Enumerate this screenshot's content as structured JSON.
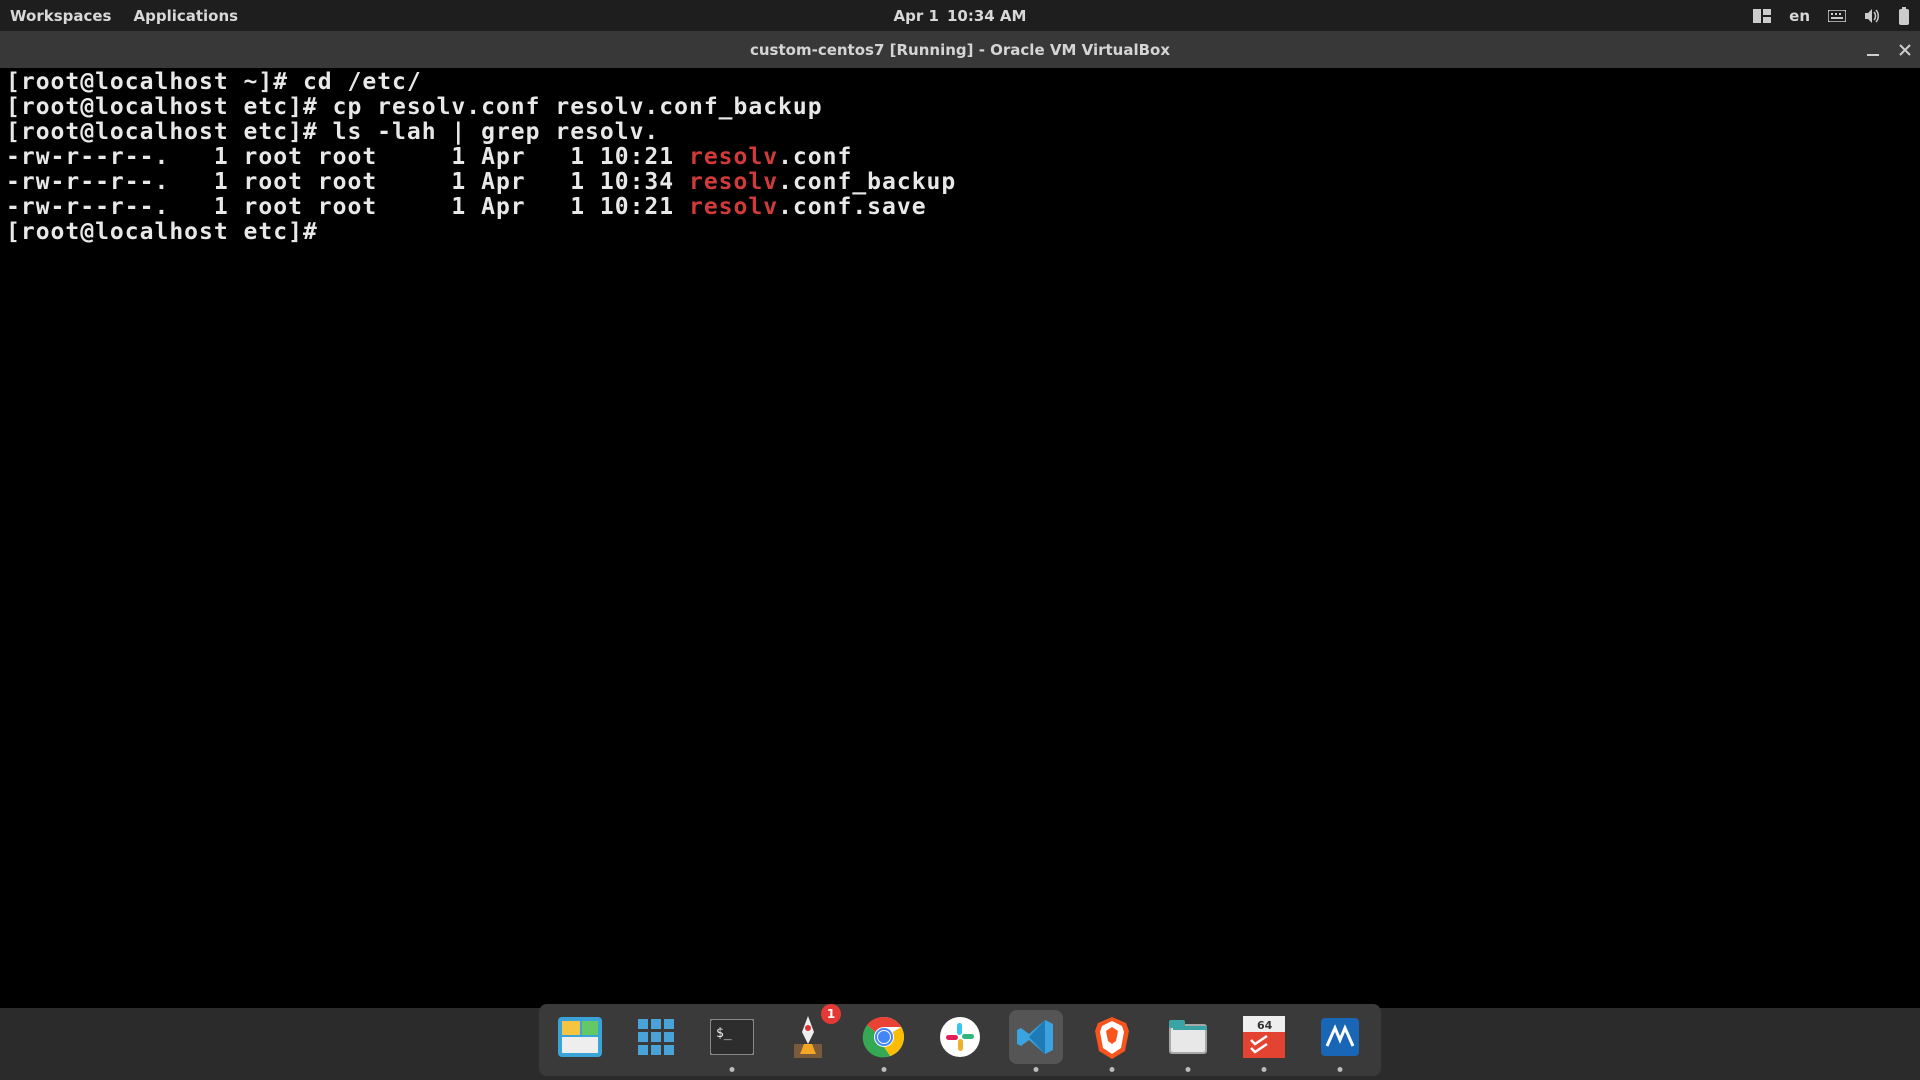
{
  "topbar": {
    "workspaces": "Workspaces",
    "applications": "Applications",
    "date": "Apr 1",
    "time": "10:34 AM",
    "language": "en",
    "icons": [
      "tiling-icon",
      "keyboard-icon",
      "volume-icon",
      "battery-icon"
    ]
  },
  "window": {
    "title": "custom-centos7 [Running] - Oracle VM VirtualBox"
  },
  "terminal": {
    "lines": [
      {
        "prompt": "[root@localhost ~]# ",
        "cmd": "cd /etc/"
      },
      {
        "prompt": "[root@localhost etc]# ",
        "cmd": "cp resolv.conf resolv.conf_backup"
      },
      {
        "prompt": "[root@localhost etc]# ",
        "cmd": "ls -lah | grep resolv."
      },
      {
        "ls_prefix": "-rw-r--r--.   1 root root     1 Apr   1 10:21 ",
        "match": "resolv",
        "suffix": ".conf"
      },
      {
        "ls_prefix": "-rw-r--r--.   1 root root     1 Apr   1 10:34 ",
        "match": "resolv",
        "suffix": ".conf_backup"
      },
      {
        "ls_prefix": "-rw-r--r--.   1 root root     1 Apr   1 10:21 ",
        "match": "resolv",
        "suffix": ".conf.save"
      },
      {
        "prompt": "[root@localhost etc]# ",
        "cmd": ""
      }
    ]
  },
  "dock": {
    "items": [
      {
        "name": "desktop-icon",
        "running": false,
        "badge": null
      },
      {
        "name": "apps-grid-icon",
        "running": false,
        "badge": null
      },
      {
        "name": "terminal-icon",
        "running": true,
        "badge": null
      },
      {
        "name": "rocket-launcher-icon",
        "running": false,
        "badge": "1"
      },
      {
        "name": "chrome-icon",
        "running": true,
        "badge": null
      },
      {
        "name": "slack-icon",
        "running": false,
        "badge": null
      },
      {
        "name": "vscode-icon",
        "running": true,
        "badge": null,
        "active": true
      },
      {
        "name": "brave-icon",
        "running": true,
        "badge": null
      },
      {
        "name": "files-icon",
        "running": true,
        "badge": null
      },
      {
        "name": "calendar-todoist-icon",
        "running": true,
        "badge": null
      },
      {
        "name": "virtualbox-icon",
        "running": true,
        "badge": null
      }
    ]
  }
}
